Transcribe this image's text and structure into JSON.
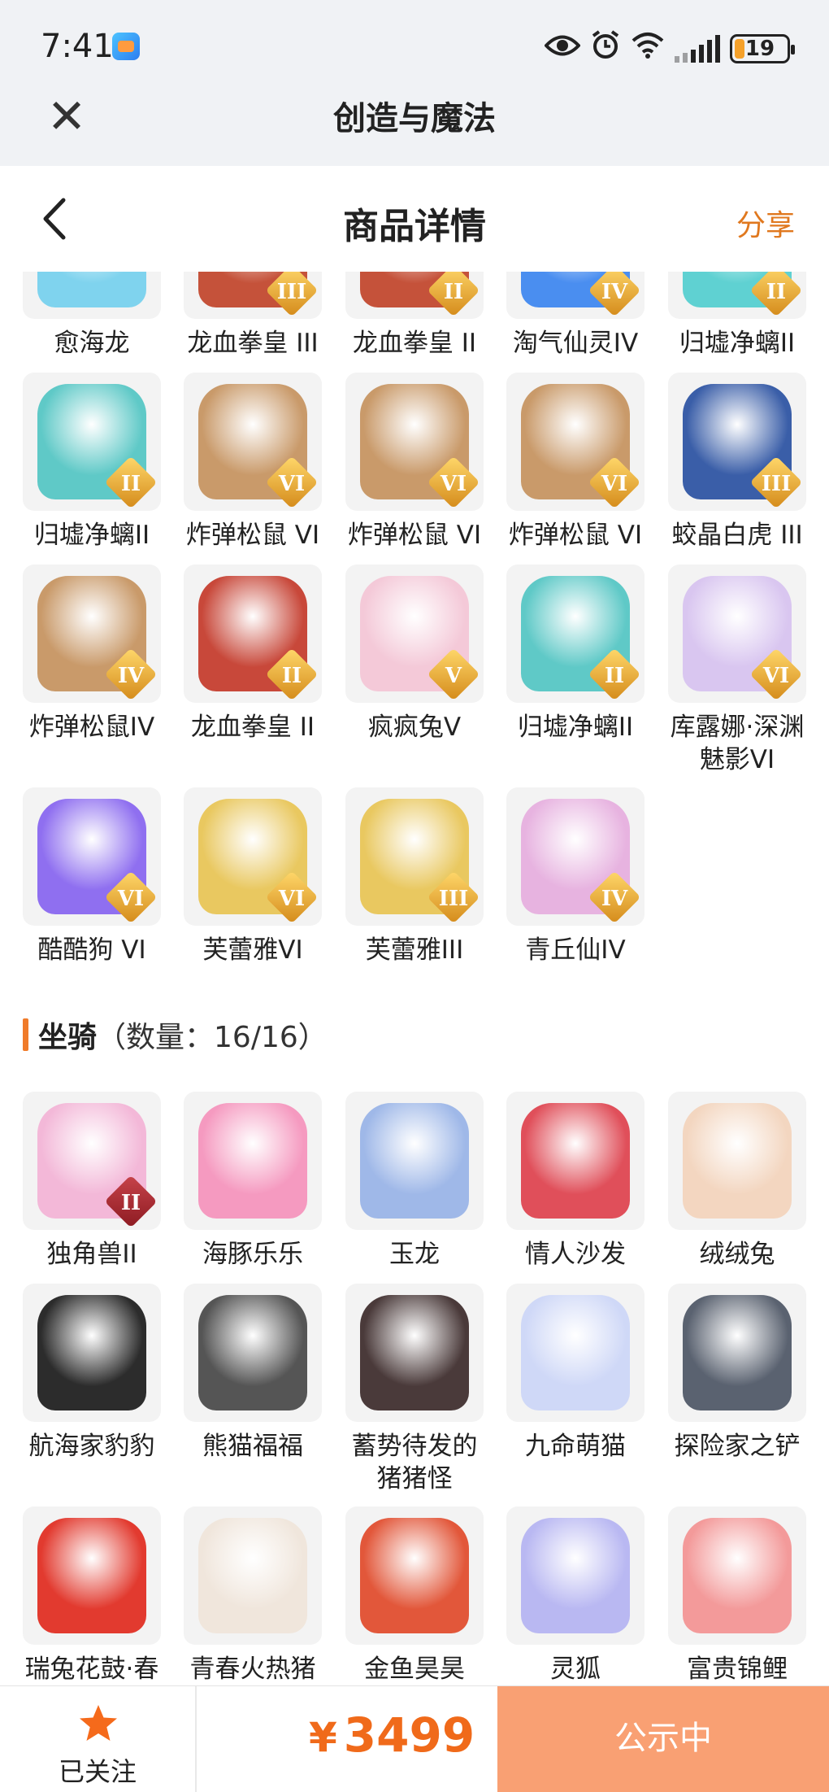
{
  "status_bar": {
    "time": "7:41",
    "battery": "19",
    "battery_level": 0.19,
    "icons": [
      "eye-icon",
      "alarm-icon",
      "wifi-icon",
      "signal-icon",
      "battery-icon"
    ]
  },
  "app_bar": {
    "title": "创造与魔法",
    "close_icon": "close-icon"
  },
  "nav": {
    "title": "商品详情",
    "share": "分享",
    "back_icon": "chevron-left-icon"
  },
  "pets": [
    {
      "name": "愈海龙",
      "grade": "",
      "color": "#7fd3ee"
    },
    {
      "name": "龙血拳皇 III",
      "grade": "III",
      "color": "#c5523a"
    },
    {
      "name": "龙血拳皇 II",
      "grade": "II",
      "color": "#c5523a"
    },
    {
      "name": "淘气仙灵IV",
      "grade": "IV",
      "color": "#4a8ef0"
    },
    {
      "name": "归墟净螭II",
      "grade": "II",
      "color": "#5fd1d2"
    },
    {
      "name": "归墟净螭II",
      "grade": "II",
      "color": "#5fc9c7"
    },
    {
      "name": "炸弹松鼠 VI",
      "grade": "VI",
      "color": "#c99a6a"
    },
    {
      "name": "炸弹松鼠 VI",
      "grade": "VI",
      "color": "#c99a6a"
    },
    {
      "name": "炸弹松鼠 VI",
      "grade": "VI",
      "color": "#c99a6a"
    },
    {
      "name": "蛟晶白虎 III",
      "grade": "III",
      "color": "#3a5ea8"
    },
    {
      "name": "炸弹松鼠IV",
      "grade": "IV",
      "color": "#c99a6a"
    },
    {
      "name": "龙血拳皇 II",
      "grade": "II",
      "color": "#c8483a"
    },
    {
      "name": "疯疯兔V",
      "grade": "V",
      "color": "#f4c9d8"
    },
    {
      "name": "归墟净螭II",
      "grade": "II",
      "color": "#5fc9c7"
    },
    {
      "name": "库露娜·深渊魅影VI",
      "grade": "VI",
      "color": "#d9c6f0"
    },
    {
      "name": "酷酷狗 VI",
      "grade": "VI",
      "color": "#8f6ff0"
    },
    {
      "name": "芙蕾雅VI",
      "grade": "VI",
      "color": "#e9c860"
    },
    {
      "name": "芙蕾雅III",
      "grade": "III",
      "color": "#e9c860"
    },
    {
      "name": "青丘仙IV",
      "grade": "IV",
      "color": "#e7b3e0"
    }
  ],
  "mounts_section": {
    "title": "坐骑",
    "count_text": "（数量：16/16）",
    "count": 16,
    "total": 16
  },
  "mounts": [
    {
      "name": "独角兽II",
      "grade": "II",
      "color": "#f3b8d8"
    },
    {
      "name": "海豚乐乐",
      "grade": "",
      "color": "#f59ac0"
    },
    {
      "name": "玉龙",
      "grade": "",
      "color": "#9fb8e8"
    },
    {
      "name": "情人沙发",
      "grade": "",
      "color": "#e04f5a"
    },
    {
      "name": "绒绒兔",
      "grade": "",
      "color": "#f3d6c0"
    },
    {
      "name": "航海家豹豹",
      "grade": "",
      "color": "#2c2c2c"
    },
    {
      "name": "熊猫福福",
      "grade": "",
      "color": "#555555"
    },
    {
      "name": "蓄势待发的猪猪怪",
      "grade": "",
      "color": "#4a3a3a"
    },
    {
      "name": "九命萌猫",
      "grade": "",
      "color": "#cfd8f7"
    },
    {
      "name": "探险家之铲",
      "grade": "",
      "color": "#5a6270"
    },
    {
      "name": "瑞兔花鼓·春",
      "grade": "",
      "color": "#e23a2f"
    },
    {
      "name": "青春火热猪",
      "grade": "",
      "color": "#f0e6dc"
    },
    {
      "name": "金鱼昊昊",
      "grade": "",
      "color": "#e2573a"
    },
    {
      "name": "灵狐",
      "grade": "",
      "color": "#b9b8f2"
    },
    {
      "name": "富贵锦鲤",
      "grade": "",
      "color": "#f39a9a"
    }
  ],
  "bottom_bar": {
    "follow_label": "已关注",
    "price_symbol": "¥",
    "price": "3499",
    "status_button": "公示中",
    "accent": "#f06a1a",
    "button_color": "#f9a073"
  }
}
